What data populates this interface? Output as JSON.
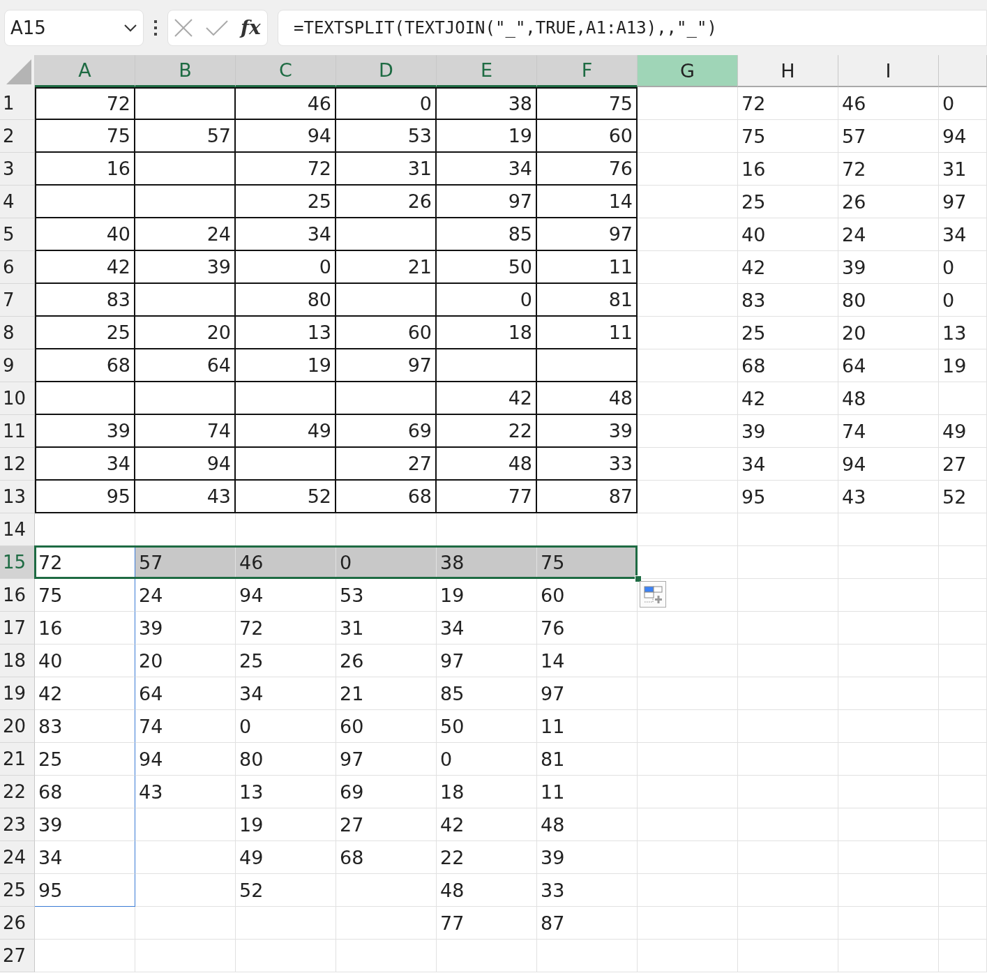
{
  "name_box": {
    "value": "A15"
  },
  "formula_bar": {
    "fx_label": "fx",
    "formula": "=TEXTSPLIT(TEXTJOIN(\"_\",TRUE,A1:A13),,\"_\")"
  },
  "columns": [
    {
      "label": "A",
      "in_selection": true,
      "selected": false
    },
    {
      "label": "B",
      "in_selection": true,
      "selected": false
    },
    {
      "label": "C",
      "in_selection": true,
      "selected": false
    },
    {
      "label": "D",
      "in_selection": true,
      "selected": false
    },
    {
      "label": "E",
      "in_selection": true,
      "selected": false
    },
    {
      "label": "F",
      "in_selection": true,
      "selected": false
    },
    {
      "label": "G",
      "in_selection": false,
      "selected": true
    },
    {
      "label": "H",
      "in_selection": false,
      "selected": false
    },
    {
      "label": "I",
      "in_selection": false,
      "selected": false
    }
  ],
  "rows": [
    {
      "label": "1",
      "boxed": true,
      "numbers": {
        "A": "72",
        "C": "46",
        "D": "0",
        "E": "38",
        "F": "75"
      },
      "text": {
        "H": "72",
        "I": "46",
        "J": "0"
      }
    },
    {
      "label": "2",
      "boxed": true,
      "numbers": {
        "A": "75",
        "B": "57",
        "C": "94",
        "D": "53",
        "E": "19",
        "F": "60"
      },
      "text": {
        "H": "75",
        "I": "57",
        "J": "94"
      }
    },
    {
      "label": "3",
      "boxed": true,
      "numbers": {
        "A": "16",
        "C": "72",
        "D": "31",
        "E": "34",
        "F": "76"
      },
      "text": {
        "H": "16",
        "I": "72",
        "J": "31"
      }
    },
    {
      "label": "4",
      "boxed": true,
      "numbers": {
        "C": "25",
        "D": "26",
        "E": "97",
        "F": "14"
      },
      "text": {
        "H": "25",
        "I": "26",
        "J": "97"
      }
    },
    {
      "label": "5",
      "boxed": true,
      "numbers": {
        "A": "40",
        "B": "24",
        "C": "34",
        "E": "85",
        "F": "97"
      },
      "text": {
        "H": "40",
        "I": "24",
        "J": "34"
      }
    },
    {
      "label": "6",
      "boxed": true,
      "numbers": {
        "A": "42",
        "B": "39",
        "C": "0",
        "D": "21",
        "E": "50",
        "F": "11"
      },
      "text": {
        "H": "42",
        "I": "39",
        "J": "0"
      }
    },
    {
      "label": "7",
      "boxed": true,
      "numbers": {
        "A": "83",
        "C": "80",
        "E": "0",
        "F": "81"
      },
      "text": {
        "H": "83",
        "I": "80",
        "J": "0"
      }
    },
    {
      "label": "8",
      "boxed": true,
      "numbers": {
        "A": "25",
        "B": "20",
        "C": "13",
        "D": "60",
        "E": "18",
        "F": "11"
      },
      "text": {
        "H": "25",
        "I": "20",
        "J": "13"
      }
    },
    {
      "label": "9",
      "boxed": true,
      "numbers": {
        "A": "68",
        "B": "64",
        "C": "19",
        "D": "97"
      },
      "text": {
        "H": "68",
        "I": "64",
        "J": "19"
      }
    },
    {
      "label": "10",
      "boxed": true,
      "numbers": {
        "E": "42",
        "F": "48"
      },
      "text": {
        "H": "42",
        "I": "48"
      }
    },
    {
      "label": "11",
      "boxed": true,
      "numbers": {
        "A": "39",
        "B": "74",
        "C": "49",
        "D": "69",
        "E": "22",
        "F": "39"
      },
      "text": {
        "H": "39",
        "I": "74",
        "J": "49"
      }
    },
    {
      "label": "12",
      "boxed": true,
      "numbers": {
        "A": "34",
        "B": "94",
        "D": "27",
        "E": "48",
        "F": "33"
      },
      "text": {
        "H": "34",
        "I": "94",
        "J": "27"
      }
    },
    {
      "label": "13",
      "boxed": true,
      "numbers": {
        "A": "95",
        "B": "43",
        "C": "52",
        "D": "68",
        "E": "77",
        "F": "87"
      },
      "text": {
        "H": "95",
        "I": "43",
        "J": "52"
      }
    },
    {
      "label": "14"
    },
    {
      "label": "15",
      "selected": true,
      "spill": true,
      "text": {
        "A": "72",
        "B": "57",
        "C": "46",
        "D": "0",
        "E": "38",
        "F": "75"
      }
    },
    {
      "label": "16",
      "spill": true,
      "text": {
        "A": "75",
        "B": "24",
        "C": "94",
        "D": "53",
        "E": "19",
        "F": "60"
      }
    },
    {
      "label": "17",
      "spill": true,
      "text": {
        "A": "16",
        "B": "39",
        "C": "72",
        "D": "31",
        "E": "34",
        "F": "76"
      }
    },
    {
      "label": "18",
      "spill": true,
      "text": {
        "A": "40",
        "B": "20",
        "C": "25",
        "D": "26",
        "E": "97",
        "F": "14"
      }
    },
    {
      "label": "19",
      "spill": true,
      "text": {
        "A": "42",
        "B": "64",
        "C": "34",
        "D": "21",
        "E": "85",
        "F": "97"
      }
    },
    {
      "label": "20",
      "spill": true,
      "text": {
        "A": "83",
        "B": "74",
        "C": "0",
        "D": "60",
        "E": "50",
        "F": "11"
      }
    },
    {
      "label": "21",
      "spill": true,
      "text": {
        "A": "25",
        "B": "94",
        "C": "80",
        "D": "97",
        "E": "0",
        "F": "81"
      }
    },
    {
      "label": "22",
      "spill": true,
      "text": {
        "A": "68",
        "B": "43",
        "C": "13",
        "D": "69",
        "E": "18",
        "F": "11"
      }
    },
    {
      "label": "23",
      "spill": true,
      "text": {
        "A": "39",
        "C": "19",
        "D": "27",
        "E": "42",
        "F": "48"
      }
    },
    {
      "label": "24",
      "spill": true,
      "text": {
        "A": "34",
        "C": "49",
        "D": "68",
        "E": "22",
        "F": "39"
      }
    },
    {
      "label": "25",
      "spill": true,
      "text": {
        "A": "95",
        "C": "52",
        "E": "48",
        "F": "33"
      }
    },
    {
      "label": "26",
      "text": {
        "E": "77",
        "F": "87"
      }
    },
    {
      "label": "27"
    }
  ]
}
